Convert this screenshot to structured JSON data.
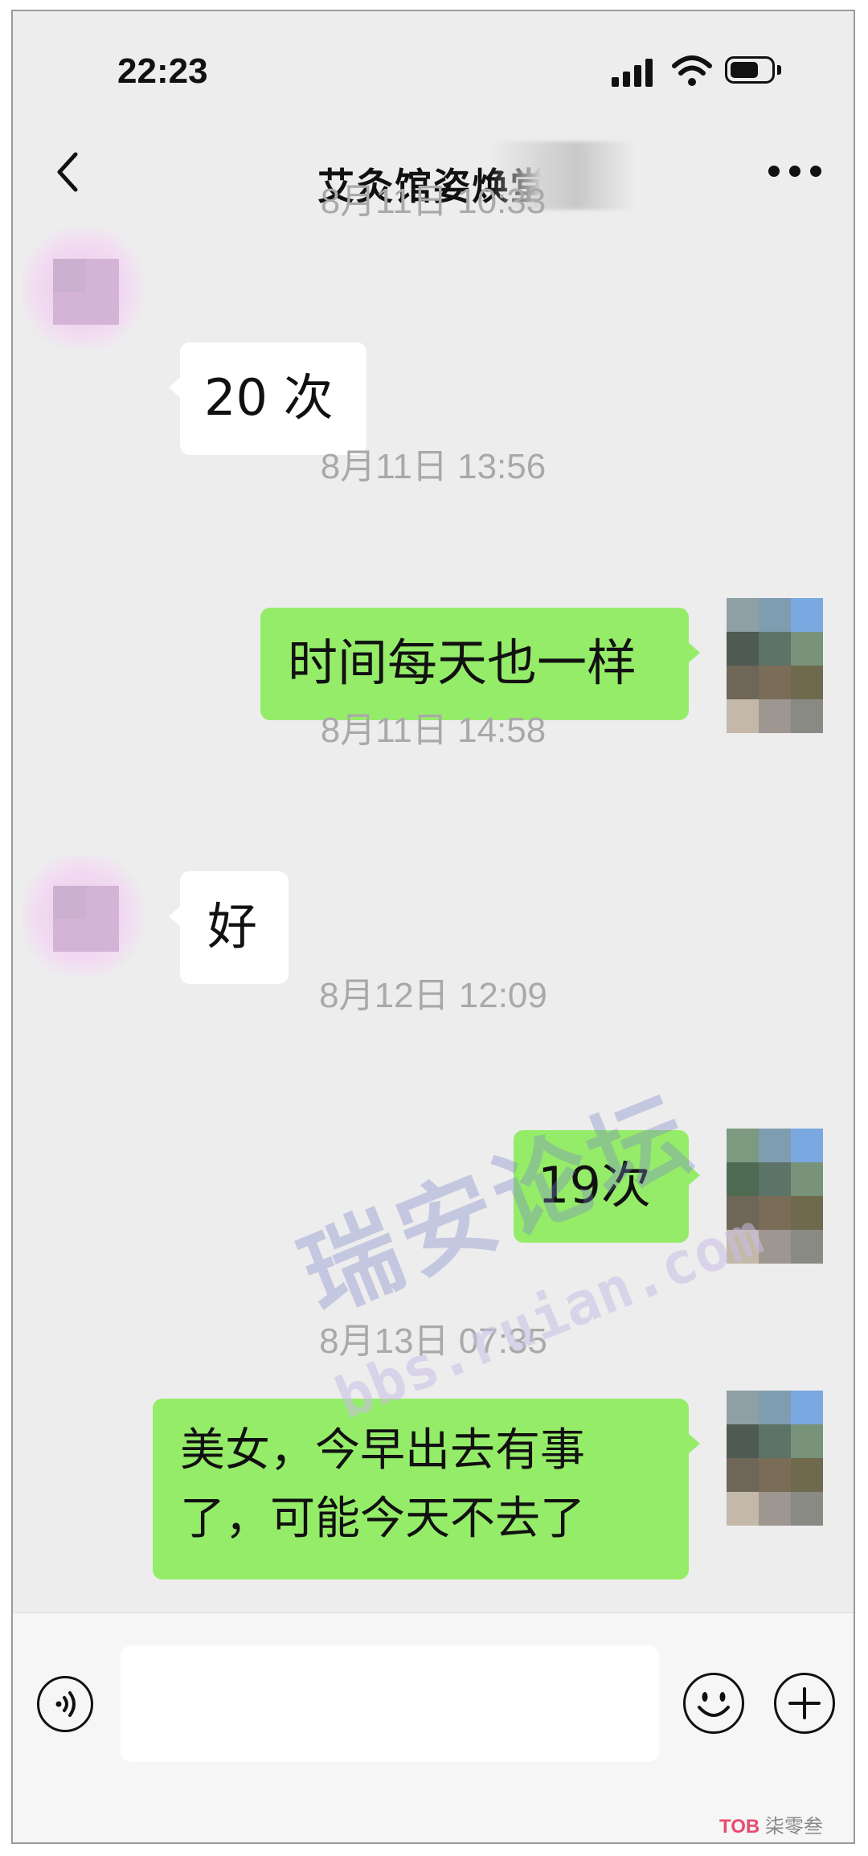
{
  "status_bar": {
    "time": "22:23"
  },
  "nav": {
    "title": "艾灸馆姿焕堂",
    "back_icon": "chevron-left-icon",
    "more_icon": "more-dots-icon"
  },
  "messages": [
    {
      "timestamp": "8月11日 10:33",
      "side": "in",
      "text": "20 次"
    },
    {
      "timestamp": "8月11日 13:56",
      "side": "out",
      "text": "时间每天也一样"
    },
    {
      "timestamp": "8月11日 14:58",
      "side": "in",
      "text": "好"
    },
    {
      "timestamp": "8月12日 12:09",
      "side": "out",
      "text": "19次"
    },
    {
      "timestamp": "8月13日 07:35",
      "side": "out",
      "text": "美女，今早出去有事了，可能今天不去了"
    }
  ],
  "watermark": {
    "main": "瑞安论坛",
    "url": "bbs.ruian.com"
  },
  "input_bar": {
    "voice_icon": "voice-icon",
    "emoji_icon": "emoji-icon",
    "plus_icon": "plus-icon"
  },
  "corner_logo": {
    "mark": "TOB",
    "text": "柒零叁"
  },
  "colors": {
    "background": "#ededed",
    "outgoing_bubble": "#95ec69",
    "incoming_bubble": "#ffffff",
    "timestamp": "#a9a9a9"
  }
}
